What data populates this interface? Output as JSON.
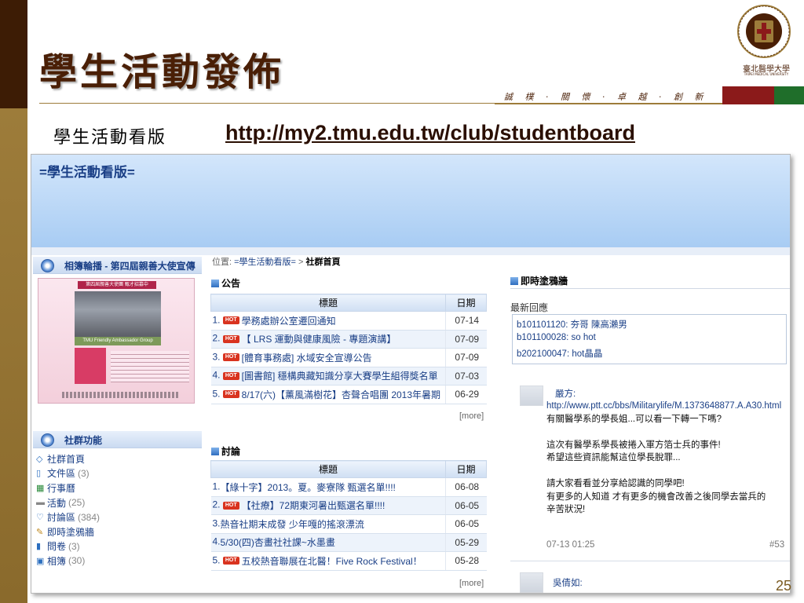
{
  "slide": {
    "title": "學生活動發佈",
    "motto": "誠 樸 · 關 懷 · 卓 越 · 創 新",
    "logo_name": "臺北醫學大學",
    "logo_sub": "TAIPEI MEDICAL UNIVERSITY",
    "subtitle": "學生活動看版",
    "link": "http://my2.tmu.edu.tw/club/studentboard",
    "page_number": "25",
    "colors": {
      "dark_brown": "#3d1c05",
      "gold": "#9d7c3a",
      "red": "#8b1a1a",
      "green": "#1f6e2a"
    }
  },
  "screenshot": {
    "header_title": "=學生活動看版=",
    "album_panel": {
      "title": "相簿輪播 - 第四屆親善大使宣傳",
      "album_banner": "第四屆親善大使團 甄才招募中",
      "album_caption": "TMU Friendly Ambassador Group"
    },
    "functions_panel": {
      "title": "社群功能",
      "items": [
        {
          "label": "社群首頁",
          "count": "",
          "icon": "tag-icon"
        },
        {
          "label": "文件區",
          "count": "(3)",
          "icon": "document-icon"
        },
        {
          "label": "行事曆",
          "count": "",
          "icon": "calendar-icon"
        },
        {
          "label": "活動",
          "count": "(25)",
          "icon": "activity-icon"
        },
        {
          "label": "討論區",
          "count": "(384)",
          "icon": "chat-icon"
        },
        {
          "label": "即時塗鴉牆",
          "count": "",
          "icon": "pencil-icon"
        },
        {
          "label": "問卷",
          "count": "(3)",
          "icon": "bar-chart-icon"
        },
        {
          "label": "相簿",
          "count": "(30)",
          "icon": "photo-icon"
        }
      ]
    },
    "breadcrumb": {
      "prefix": "位置:",
      "root": "=學生活動看版=",
      "sep": ">",
      "current": "社群首頁"
    },
    "announcements": {
      "title": "公告",
      "col_title": "標題",
      "col_date": "日期",
      "rows": [
        {
          "num": "1.",
          "hot": true,
          "title": "學務處辦公室遷回通知",
          "date": "07-14"
        },
        {
          "num": "2.",
          "hot": true,
          "title": "【 LRS 運動與健康風險 - 專題演講】",
          "date": "07-09"
        },
        {
          "num": "3.",
          "hot": true,
          "title": "[體育事務處] 水域安全宣導公告",
          "date": "07-09"
        },
        {
          "num": "4.",
          "hot": true,
          "title": "[圖書館] 穩構典藏知識分享大賽學生組得獎名單",
          "date": "07-03"
        },
        {
          "num": "5.",
          "hot": true,
          "title": "8/17(六)【薰風滿樹花】杏聲合唱團 2013年暑期",
          "date": "06-29"
        }
      ],
      "more": "[more]"
    },
    "discussions": {
      "title": "討論",
      "col_title": "標題",
      "col_date": "日期",
      "rows": [
        {
          "num": "1.",
          "hot": false,
          "title": "【綠十字】2013。夏。麥寮隊 甄選名單!!!!",
          "date": "06-08"
        },
        {
          "num": "2.",
          "hot": true,
          "title": "【社療】72期東河暑出甄選名單!!!!",
          "date": "06-05"
        },
        {
          "num": "3.",
          "hot": false,
          "title": "熱音社期末成發 少年嘎的搖滾漂流",
          "date": "06-05"
        },
        {
          "num": "4.",
          "hot": false,
          "title": "5/30(四)杏畫社社課~水墨畫",
          "date": "05-29"
        },
        {
          "num": "5.",
          "hot": true,
          "title": "五校熱音聯展在北醫！Five Rock Festival！",
          "date": "05-28"
        }
      ],
      "more": "[more]"
    },
    "graffiti": {
      "title": "即時塗鴉牆",
      "latest_label": "最新回應",
      "latest": [
        "b101101120: 夯哥 陳高瀨男",
        "b101100028: so hot",
        "b202100047: hot晶晶"
      ],
      "comment": {
        "author": "嚴方:",
        "url": "http://www.ptt.cc/bbs/Militarylife/M.1373648877.A.A30.html",
        "lines": [
          "有關醫學系的學長姐...可以看一下轉一下嗎?",
          "",
          "這次有醫學系學長被捲入軍方箔士兵的事件!",
          "希望這些資訊能幫這位學長脫罪...",
          "",
          "請大家看看並分享給認識的同學吧!",
          "有更多的人知道 才有更多的機會改善之後同學去當兵的",
          "辛苦狀況!"
        ],
        "time": "07-13 01:25",
        "number": "#53"
      },
      "next_author": "吳倩如:"
    }
  }
}
